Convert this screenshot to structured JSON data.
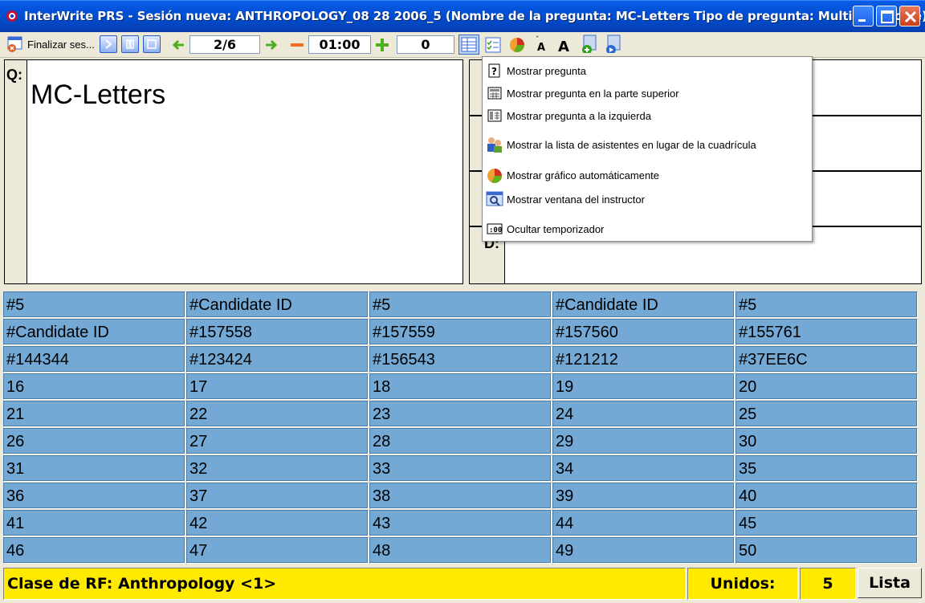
{
  "window": {
    "title": "InterWrite PRS - Sesión nueva: ANTHROPOLOGY_08 28 2006_5 (Nombre de la pregunta: MC-Letters  Tipo de pregunta: Multiple Choice)"
  },
  "toolbar": {
    "finish_label": "Finalizar ses...",
    "question_counter": "2/6",
    "timer": "01:00",
    "responses": "0"
  },
  "question": {
    "label": "Q:",
    "text": "MC-Letters"
  },
  "answers": {
    "visible_letter": "D:"
  },
  "menu": {
    "items": [
      {
        "label": "Mostrar pregunta",
        "icon": "question-icon"
      },
      {
        "label": "Mostrar pregunta en la parte superior",
        "icon": "layout-top-icon"
      },
      {
        "label": "Mostrar pregunta a la izquierda",
        "icon": "layout-left-icon"
      },
      {
        "label": "Mostrar la lista de asistentes en lugar de la cuadrícula",
        "icon": "attendees-icon"
      },
      {
        "label": "Mostrar gráfico automáticamente",
        "icon": "pie-chart-icon"
      },
      {
        "label": "Mostrar ventana del instructor",
        "icon": "instructor-window-icon"
      },
      {
        "label": "Ocultar temporizador",
        "icon": "timer-icon"
      }
    ]
  },
  "grid": {
    "rows": [
      [
        "#5",
        "#Candidate ID",
        "#5",
        "#Candidate ID",
        "#5"
      ],
      [
        "#Candidate ID",
        "#157558",
        "#157559",
        "#157560",
        "#155761"
      ],
      [
        "#144344",
        "#123424",
        "#156543",
        "#121212",
        "#37EE6C"
      ],
      [
        "16",
        "17",
        "18",
        "19",
        "20"
      ],
      [
        "21",
        "22",
        "23",
        "24",
        "25"
      ],
      [
        "26",
        "27",
        "28",
        "29",
        "30"
      ],
      [
        "31",
        "32",
        "33",
        "34",
        "35"
      ],
      [
        "36",
        "37",
        "38",
        "39",
        "40"
      ],
      [
        "41",
        "42",
        "43",
        "44",
        "45"
      ],
      [
        "46",
        "47",
        "48",
        "49",
        "50"
      ]
    ]
  },
  "status": {
    "class_label": "Clase de RF: Anthropology <1>",
    "joined_label": "Unidos:",
    "joined_count": "5",
    "list_button": "Lista"
  },
  "colors": {
    "titlebar": "#0352d9",
    "grid_cell": "#73a9d4",
    "status_bar": "#ffea00"
  }
}
